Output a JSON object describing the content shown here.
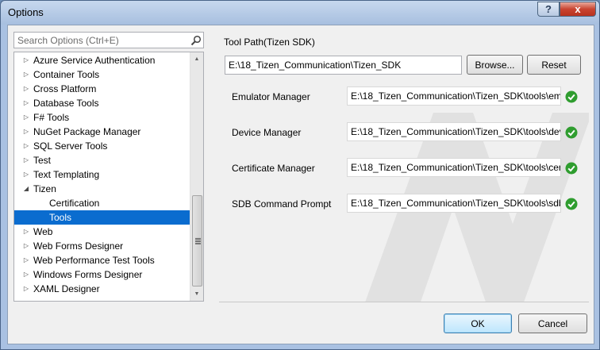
{
  "window": {
    "title": "Options"
  },
  "titlebar": {
    "help_label": "?",
    "close_label": "x"
  },
  "search": {
    "placeholder": "Search Options (Ctrl+E)"
  },
  "tree": {
    "items": [
      {
        "label": "Azure Service Authentication",
        "level": 0,
        "expanded": false,
        "selected": false
      },
      {
        "label": "Container Tools",
        "level": 0,
        "expanded": false,
        "selected": false
      },
      {
        "label": "Cross Platform",
        "level": 0,
        "expanded": false,
        "selected": false
      },
      {
        "label": "Database Tools",
        "level": 0,
        "expanded": false,
        "selected": false
      },
      {
        "label": "F# Tools",
        "level": 0,
        "expanded": false,
        "selected": false
      },
      {
        "label": "NuGet Package Manager",
        "level": 0,
        "expanded": false,
        "selected": false
      },
      {
        "label": "SQL Server Tools",
        "level": 0,
        "expanded": false,
        "selected": false
      },
      {
        "label": "Test",
        "level": 0,
        "expanded": false,
        "selected": false
      },
      {
        "label": "Text Templating",
        "level": 0,
        "expanded": false,
        "selected": false
      },
      {
        "label": "Tizen",
        "level": 0,
        "expanded": true,
        "selected": false
      },
      {
        "label": "Certification",
        "level": 1,
        "expanded": false,
        "selected": false
      },
      {
        "label": "Tools",
        "level": 1,
        "expanded": false,
        "selected": true
      },
      {
        "label": "Web",
        "level": 0,
        "expanded": false,
        "selected": false
      },
      {
        "label": "Web Forms Designer",
        "level": 0,
        "expanded": false,
        "selected": false
      },
      {
        "label": "Web Performance Test Tools",
        "level": 0,
        "expanded": false,
        "selected": false
      },
      {
        "label": "Windows Forms Designer",
        "level": 0,
        "expanded": false,
        "selected": false
      },
      {
        "label": "XAML Designer",
        "level": 0,
        "expanded": false,
        "selected": false
      }
    ]
  },
  "panel": {
    "section_label": "Tool Path(Tizen SDK)",
    "tool_path": "E:\\18_Tizen_Communication\\Tizen_SDK",
    "browse_label": "Browse...",
    "reset_label": "Reset",
    "tools": [
      {
        "label": "Emulator Manager",
        "path": "E:\\18_Tizen_Communication\\Tizen_SDK\\tools\\em"
      },
      {
        "label": "Device Manager",
        "path": "E:\\18_Tizen_Communication\\Tizen_SDK\\tools\\dev"
      },
      {
        "label": "Certificate Manager",
        "path": "E:\\18_Tizen_Communication\\Tizen_SDK\\tools\\cer"
      },
      {
        "label": "SDB Command Prompt",
        "path": "E:\\18_Tizen_Communication\\Tizen_SDK\\tools\\sdb"
      }
    ]
  },
  "footer": {
    "ok_label": "OK",
    "cancel_label": "Cancel"
  },
  "colors": {
    "selection": "#0a6ccf",
    "check_ok": "#2f9d2f",
    "accent": "#3c7fb1"
  }
}
